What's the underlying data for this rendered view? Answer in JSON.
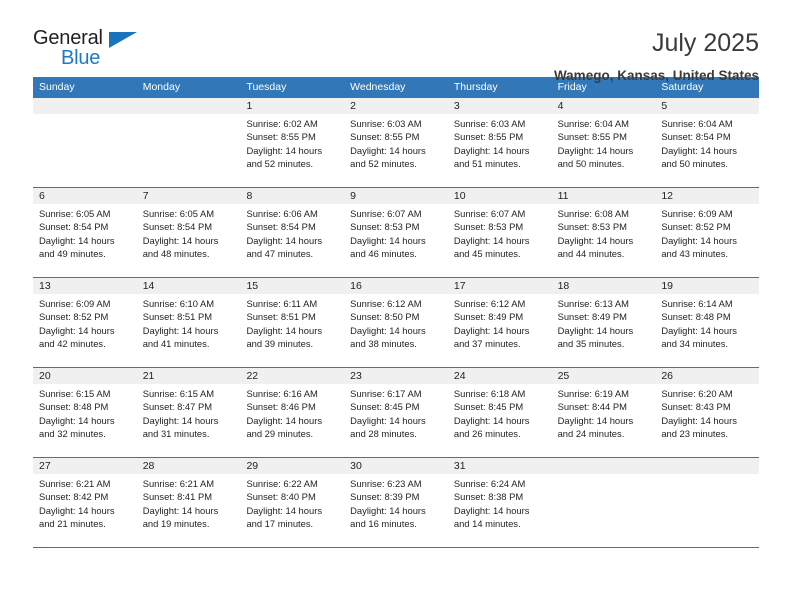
{
  "brand": {
    "name_part1": "General",
    "name_part2": "Blue",
    "accent_color": "#1f7ac4",
    "triangle_color": "#1a73bd"
  },
  "header": {
    "title": "July 2025",
    "subtitle": "Wamego, Kansas, United States"
  },
  "calendar": {
    "header_bg": "#3278b9",
    "daystrip_bg": "#f0f0f0",
    "weekdays": [
      "Sunday",
      "Monday",
      "Tuesday",
      "Wednesday",
      "Thursday",
      "Friday",
      "Saturday"
    ],
    "weeks": [
      [
        {
          "day": "",
          "sunrise": "",
          "sunset": "",
          "daylight_line1": "",
          "daylight_line2": ""
        },
        {
          "day": "",
          "sunrise": "",
          "sunset": "",
          "daylight_line1": "",
          "daylight_line2": ""
        },
        {
          "day": "1",
          "sunrise": "Sunrise: 6:02 AM",
          "sunset": "Sunset: 8:55 PM",
          "daylight_line1": "Daylight: 14 hours",
          "daylight_line2": "and 52 minutes."
        },
        {
          "day": "2",
          "sunrise": "Sunrise: 6:03 AM",
          "sunset": "Sunset: 8:55 PM",
          "daylight_line1": "Daylight: 14 hours",
          "daylight_line2": "and 52 minutes."
        },
        {
          "day": "3",
          "sunrise": "Sunrise: 6:03 AM",
          "sunset": "Sunset: 8:55 PM",
          "daylight_line1": "Daylight: 14 hours",
          "daylight_line2": "and 51 minutes."
        },
        {
          "day": "4",
          "sunrise": "Sunrise: 6:04 AM",
          "sunset": "Sunset: 8:55 PM",
          "daylight_line1": "Daylight: 14 hours",
          "daylight_line2": "and 50 minutes."
        },
        {
          "day": "5",
          "sunrise": "Sunrise: 6:04 AM",
          "sunset": "Sunset: 8:54 PM",
          "daylight_line1": "Daylight: 14 hours",
          "daylight_line2": "and 50 minutes."
        }
      ],
      [
        {
          "day": "6",
          "sunrise": "Sunrise: 6:05 AM",
          "sunset": "Sunset: 8:54 PM",
          "daylight_line1": "Daylight: 14 hours",
          "daylight_line2": "and 49 minutes."
        },
        {
          "day": "7",
          "sunrise": "Sunrise: 6:05 AM",
          "sunset": "Sunset: 8:54 PM",
          "daylight_line1": "Daylight: 14 hours",
          "daylight_line2": "and 48 minutes."
        },
        {
          "day": "8",
          "sunrise": "Sunrise: 6:06 AM",
          "sunset": "Sunset: 8:54 PM",
          "daylight_line1": "Daylight: 14 hours",
          "daylight_line2": "and 47 minutes."
        },
        {
          "day": "9",
          "sunrise": "Sunrise: 6:07 AM",
          "sunset": "Sunset: 8:53 PM",
          "daylight_line1": "Daylight: 14 hours",
          "daylight_line2": "and 46 minutes."
        },
        {
          "day": "10",
          "sunrise": "Sunrise: 6:07 AM",
          "sunset": "Sunset: 8:53 PM",
          "daylight_line1": "Daylight: 14 hours",
          "daylight_line2": "and 45 minutes."
        },
        {
          "day": "11",
          "sunrise": "Sunrise: 6:08 AM",
          "sunset": "Sunset: 8:53 PM",
          "daylight_line1": "Daylight: 14 hours",
          "daylight_line2": "and 44 minutes."
        },
        {
          "day": "12",
          "sunrise": "Sunrise: 6:09 AM",
          "sunset": "Sunset: 8:52 PM",
          "daylight_line1": "Daylight: 14 hours",
          "daylight_line2": "and 43 minutes."
        }
      ],
      [
        {
          "day": "13",
          "sunrise": "Sunrise: 6:09 AM",
          "sunset": "Sunset: 8:52 PM",
          "daylight_line1": "Daylight: 14 hours",
          "daylight_line2": "and 42 minutes."
        },
        {
          "day": "14",
          "sunrise": "Sunrise: 6:10 AM",
          "sunset": "Sunset: 8:51 PM",
          "daylight_line1": "Daylight: 14 hours",
          "daylight_line2": "and 41 minutes."
        },
        {
          "day": "15",
          "sunrise": "Sunrise: 6:11 AM",
          "sunset": "Sunset: 8:51 PM",
          "daylight_line1": "Daylight: 14 hours",
          "daylight_line2": "and 39 minutes."
        },
        {
          "day": "16",
          "sunrise": "Sunrise: 6:12 AM",
          "sunset": "Sunset: 8:50 PM",
          "daylight_line1": "Daylight: 14 hours",
          "daylight_line2": "and 38 minutes."
        },
        {
          "day": "17",
          "sunrise": "Sunrise: 6:12 AM",
          "sunset": "Sunset: 8:49 PM",
          "daylight_line1": "Daylight: 14 hours",
          "daylight_line2": "and 37 minutes."
        },
        {
          "day": "18",
          "sunrise": "Sunrise: 6:13 AM",
          "sunset": "Sunset: 8:49 PM",
          "daylight_line1": "Daylight: 14 hours",
          "daylight_line2": "and 35 minutes."
        },
        {
          "day": "19",
          "sunrise": "Sunrise: 6:14 AM",
          "sunset": "Sunset: 8:48 PM",
          "daylight_line1": "Daylight: 14 hours",
          "daylight_line2": "and 34 minutes."
        }
      ],
      [
        {
          "day": "20",
          "sunrise": "Sunrise: 6:15 AM",
          "sunset": "Sunset: 8:48 PM",
          "daylight_line1": "Daylight: 14 hours",
          "daylight_line2": "and 32 minutes."
        },
        {
          "day": "21",
          "sunrise": "Sunrise: 6:15 AM",
          "sunset": "Sunset: 8:47 PM",
          "daylight_line1": "Daylight: 14 hours",
          "daylight_line2": "and 31 minutes."
        },
        {
          "day": "22",
          "sunrise": "Sunrise: 6:16 AM",
          "sunset": "Sunset: 8:46 PM",
          "daylight_line1": "Daylight: 14 hours",
          "daylight_line2": "and 29 minutes."
        },
        {
          "day": "23",
          "sunrise": "Sunrise: 6:17 AM",
          "sunset": "Sunset: 8:45 PM",
          "daylight_line1": "Daylight: 14 hours",
          "daylight_line2": "and 28 minutes."
        },
        {
          "day": "24",
          "sunrise": "Sunrise: 6:18 AM",
          "sunset": "Sunset: 8:45 PM",
          "daylight_line1": "Daylight: 14 hours",
          "daylight_line2": "and 26 minutes."
        },
        {
          "day": "25",
          "sunrise": "Sunrise: 6:19 AM",
          "sunset": "Sunset: 8:44 PM",
          "daylight_line1": "Daylight: 14 hours",
          "daylight_line2": "and 24 minutes."
        },
        {
          "day": "26",
          "sunrise": "Sunrise: 6:20 AM",
          "sunset": "Sunset: 8:43 PM",
          "daylight_line1": "Daylight: 14 hours",
          "daylight_line2": "and 23 minutes."
        }
      ],
      [
        {
          "day": "27",
          "sunrise": "Sunrise: 6:21 AM",
          "sunset": "Sunset: 8:42 PM",
          "daylight_line1": "Daylight: 14 hours",
          "daylight_line2": "and 21 minutes."
        },
        {
          "day": "28",
          "sunrise": "Sunrise: 6:21 AM",
          "sunset": "Sunset: 8:41 PM",
          "daylight_line1": "Daylight: 14 hours",
          "daylight_line2": "and 19 minutes."
        },
        {
          "day": "29",
          "sunrise": "Sunrise: 6:22 AM",
          "sunset": "Sunset: 8:40 PM",
          "daylight_line1": "Daylight: 14 hours",
          "daylight_line2": "and 17 minutes."
        },
        {
          "day": "30",
          "sunrise": "Sunrise: 6:23 AM",
          "sunset": "Sunset: 8:39 PM",
          "daylight_line1": "Daylight: 14 hours",
          "daylight_line2": "and 16 minutes."
        },
        {
          "day": "31",
          "sunrise": "Sunrise: 6:24 AM",
          "sunset": "Sunset: 8:38 PM",
          "daylight_line1": "Daylight: 14 hours",
          "daylight_line2": "and 14 minutes."
        },
        {
          "day": "",
          "sunrise": "",
          "sunset": "",
          "daylight_line1": "",
          "daylight_line2": ""
        },
        {
          "day": "",
          "sunrise": "",
          "sunset": "",
          "daylight_line1": "",
          "daylight_line2": ""
        }
      ]
    ]
  }
}
